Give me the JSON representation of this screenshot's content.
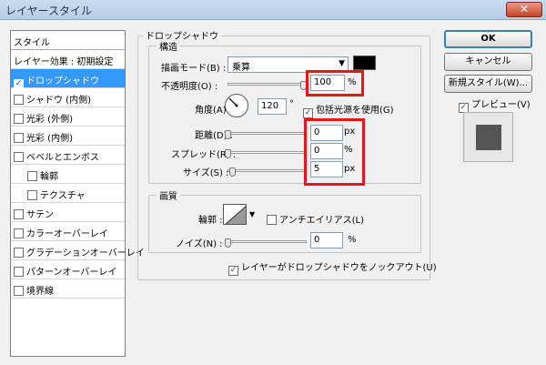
{
  "window": {
    "title": "レイヤースタイル",
    "close": "✕"
  },
  "sidebar": {
    "header": "スタイル",
    "items": [
      {
        "label": "レイヤー効果 : 初期設定",
        "checkbox": false,
        "checked": false,
        "selected": false,
        "indent": false
      },
      {
        "label": "ドロップシャドウ",
        "checkbox": true,
        "checked": true,
        "selected": true,
        "indent": false
      },
      {
        "label": "シャドウ (内側)",
        "checkbox": true,
        "checked": false,
        "selected": false,
        "indent": false
      },
      {
        "label": "光彩 (外側)",
        "checkbox": true,
        "checked": false,
        "selected": false,
        "indent": false
      },
      {
        "label": "光彩 (内側)",
        "checkbox": true,
        "checked": false,
        "selected": false,
        "indent": false
      },
      {
        "label": "ベベルとエンボス",
        "checkbox": true,
        "checked": false,
        "selected": false,
        "indent": false
      },
      {
        "label": "輪郭",
        "checkbox": true,
        "checked": false,
        "selected": false,
        "indent": true
      },
      {
        "label": "テクスチャ",
        "checkbox": true,
        "checked": false,
        "selected": false,
        "indent": true
      },
      {
        "label": "サテン",
        "checkbox": true,
        "checked": false,
        "selected": false,
        "indent": false
      },
      {
        "label": "カラーオーバーレイ",
        "checkbox": true,
        "checked": false,
        "selected": false,
        "indent": false
      },
      {
        "label": "グラデーションオーバーレイ",
        "checkbox": true,
        "checked": false,
        "selected": false,
        "indent": false
      },
      {
        "label": "パターンオーバーレイ",
        "checkbox": true,
        "checked": false,
        "selected": false,
        "indent": false
      },
      {
        "label": "境界線",
        "checkbox": true,
        "checked": false,
        "selected": false,
        "indent": false
      }
    ]
  },
  "drop_shadow": {
    "group_title": "ドロップシャドウ",
    "structure": {
      "title": "構造",
      "blend_mode_label": "描画モード(B) :",
      "blend_mode_value": "乗算",
      "shadow_color": "#000000",
      "opacity_label": "不透明度(O) :",
      "opacity_value": "100",
      "opacity_unit": "%",
      "angle_label": "角度(A) :",
      "angle_value": "120",
      "angle_unit": "°",
      "global_light_label": "包括光源を使用(G)",
      "global_light_checked": true,
      "distance_label": "距離(D) :",
      "distance_value": "0",
      "distance_unit": "px",
      "spread_label": "スプレッド(R) :",
      "spread_value": "0",
      "spread_unit": "%",
      "size_label": "サイズ(S) :",
      "size_value": "5",
      "size_unit": "px"
    },
    "quality": {
      "title": "画質",
      "contour_label": "輪郭 :",
      "anti_alias_label": "アンチエイリアス(L)",
      "anti_alias_checked": false,
      "noise_label": "ノイズ(N) :",
      "noise_value": "0",
      "noise_unit": "%"
    },
    "knockout_label": "レイヤーがドロップシャドウをノックアウト(U)",
    "knockout_checked": true
  },
  "buttons": {
    "ok": "OK",
    "cancel": "キャンセル",
    "new_style": "新規スタイル(W)...",
    "preview_label": "プレビュー(V)",
    "preview_checked": true
  },
  "colors": {
    "highlight": "#e8151a",
    "selection": "#3399ff"
  },
  "check_glyph": "✓"
}
